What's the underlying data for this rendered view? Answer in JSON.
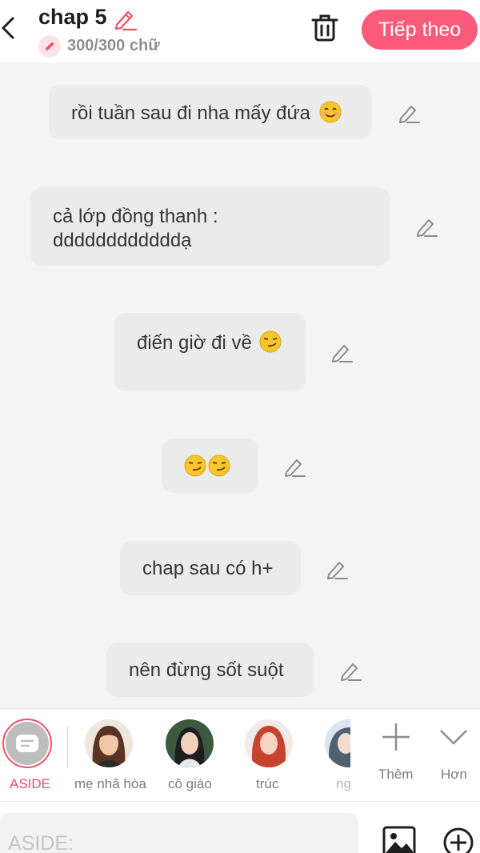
{
  "header": {
    "title": "chap 5",
    "char_count": "300/300 chữ",
    "next_label": "Tiếp theo"
  },
  "messages": [
    {
      "text": "rồi tuần sau đi nha mấy đứa",
      "emoji": "smile"
    },
    {
      "line1": "cả lớp đồng thanh :",
      "line2": "ddddddddddddạ"
    },
    {
      "text": "điến giờ đi về",
      "emoji": "smirk"
    },
    {
      "text": "",
      "emoji": "smirk-smirk"
    },
    {
      "text": "chap sau có h+"
    },
    {
      "text": "nên đừng sốt suột"
    }
  ],
  "characters": [
    {
      "name": "ASIDE",
      "selected": true
    },
    {
      "name": "mẹ nhã hòa"
    },
    {
      "name": "cô giáo"
    },
    {
      "name": "trúc"
    },
    {
      "name": "ng"
    }
  ],
  "more": {
    "add_label": "Thêm",
    "more_label": "Hơn"
  },
  "input": {
    "placeholder": "ASIDE:"
  },
  "colors": {
    "accent": "#fb5a78",
    "bubble": "#ebebeb",
    "background": "#f4f4f5"
  }
}
